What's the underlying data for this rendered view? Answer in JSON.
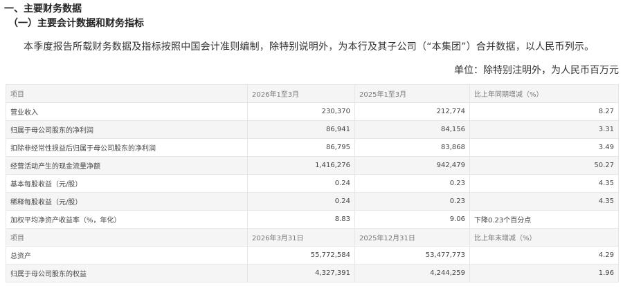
{
  "heading1": "一、主要财务数据",
  "heading2": "（一）主要会计数据和财务指标",
  "paragraph": "本季度报告所载财务数据及指标按照中国会计准则编制，除特别说明外，为本行及其子公司（“本集团”）合并数据，以人民币列示。",
  "unit": "单位：除特别注明外，为人民币百万元",
  "rows": [
    {
      "type": "header",
      "c": [
        "项目",
        "2026年1至3月",
        "2025年1至3月",
        "比上年同期增减（%）"
      ]
    },
    {
      "type": "data",
      "c": [
        "营业收入",
        "230,370",
        "212,774",
        "8.27"
      ]
    },
    {
      "type": "data",
      "c": [
        "归属于母公司股东的净利润",
        "86,941",
        "84,156",
        "3.31"
      ]
    },
    {
      "type": "data",
      "c": [
        "扣除非经常性损益后归属于母公司股东的净利润",
        "86,795",
        "83,868",
        "3.49"
      ]
    },
    {
      "type": "data",
      "c": [
        "经营活动产生的现金流量净额",
        "1,416,276",
        "942,479",
        "50.27"
      ]
    },
    {
      "type": "data",
      "c": [
        "基本每股收益（元/股）",
        "0.24",
        "0.23",
        "4.35"
      ]
    },
    {
      "type": "data",
      "c": [
        "稀释每股收益（元/股）",
        "0.24",
        "0.23",
        "4.35"
      ]
    },
    {
      "type": "data",
      "c": [
        "加权平均净资产收益率（%，年化）",
        "8.83",
        "9.06",
        "下降0.23个百分点"
      ]
    },
    {
      "type": "header",
      "c": [
        "项目",
        "2026年3月31日",
        "2025年12月31日",
        "比上年末增减（%）"
      ]
    },
    {
      "type": "data",
      "c": [
        "总资产",
        "55,772,584",
        "53,477,773",
        "4.29"
      ]
    },
    {
      "type": "data",
      "c": [
        "归属于母公司股东的权益",
        "4,327,391",
        "4,244,259",
        "1.96"
      ]
    }
  ]
}
